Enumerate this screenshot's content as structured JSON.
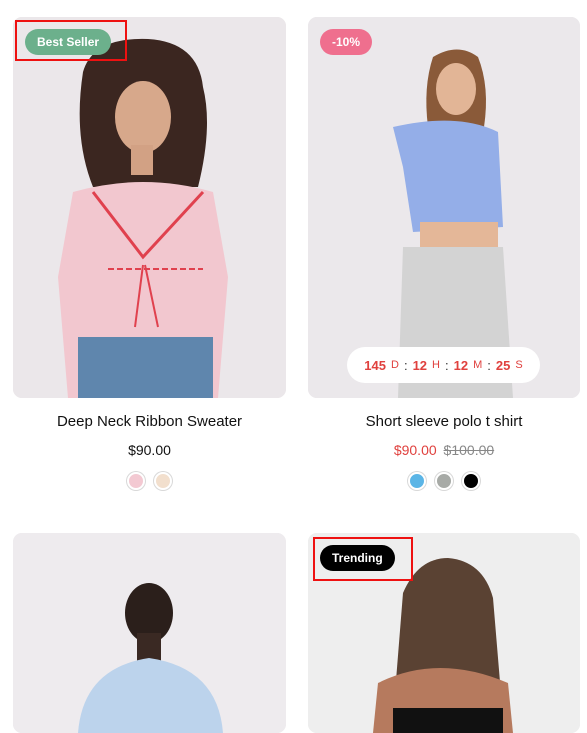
{
  "products": [
    {
      "badge": "Best Seller",
      "title": "Deep Neck Ribbon Sweater",
      "price": "$90.00",
      "swatches": [
        "#f3c9d2",
        "#f2dfcd"
      ]
    },
    {
      "badge": "-10%",
      "title": "Short sleeve polo t shirt",
      "price": "$90.00",
      "old_price": "$100.00",
      "swatches": [
        "#5bb5e6",
        "#a7aaa6",
        "#000000"
      ],
      "countdown": {
        "days": "145",
        "days_unit": "D",
        "hours": "12",
        "hours_unit": "H",
        "minutes": "12",
        "minutes_unit": "M",
        "seconds": "25",
        "seconds_unit": "S"
      }
    },
    {
      "title": ""
    },
    {
      "badge": "Trending"
    }
  ],
  "colors": {
    "badge_green": "#6cb08c",
    "badge_pink": "#ef6f8e",
    "badge_black": "#000000",
    "sale_red": "#e0413e"
  }
}
